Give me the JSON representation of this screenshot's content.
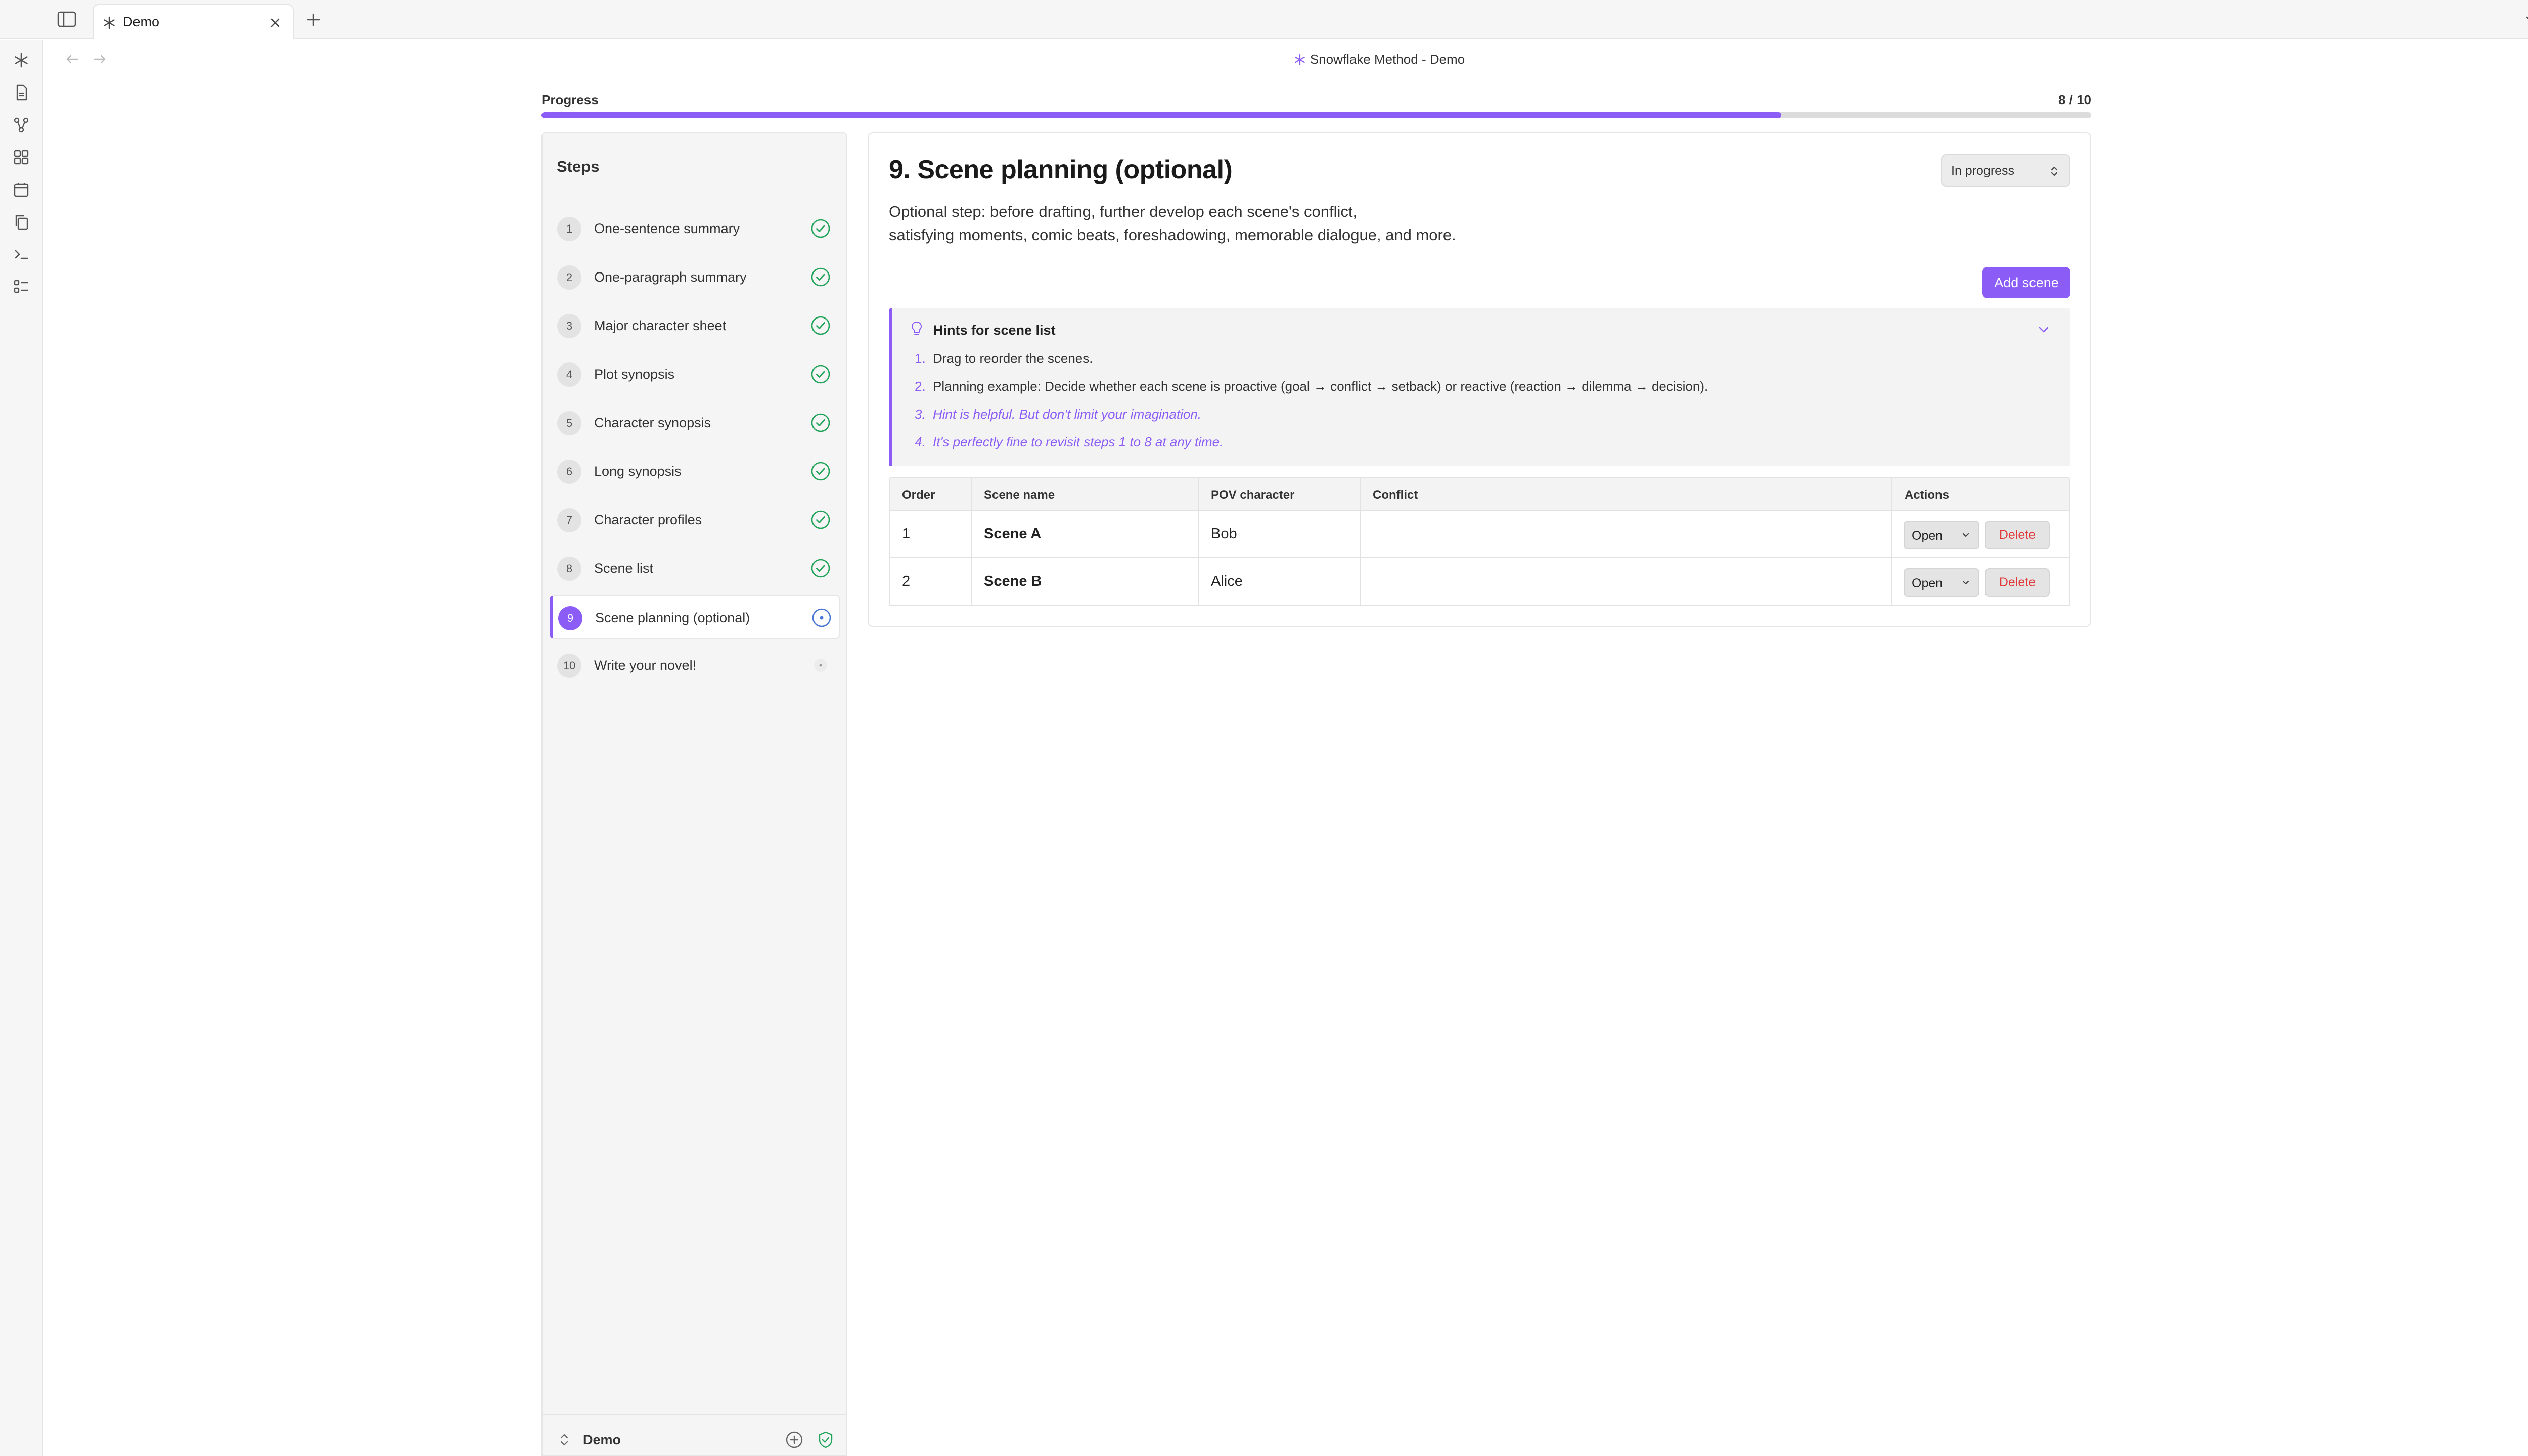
{
  "tab": {
    "label": "Demo"
  },
  "view": {
    "title": "Snowflake Method - Demo"
  },
  "progress": {
    "label": "Progress",
    "current": 8,
    "total": 10,
    "text": "8 / 10"
  },
  "steps": {
    "title": "Steps",
    "items": [
      {
        "num": "1",
        "label": "One-sentence summary",
        "status": "done"
      },
      {
        "num": "2",
        "label": "One-paragraph summary",
        "status": "done"
      },
      {
        "num": "3",
        "label": "Major character sheet",
        "status": "done"
      },
      {
        "num": "4",
        "label": "Plot synopsis",
        "status": "done"
      },
      {
        "num": "5",
        "label": "Character synopsis",
        "status": "done"
      },
      {
        "num": "6",
        "label": "Long synopsis",
        "status": "done"
      },
      {
        "num": "7",
        "label": "Character profiles",
        "status": "done"
      },
      {
        "num": "8",
        "label": "Scene list",
        "status": "done"
      },
      {
        "num": "9",
        "label": "Scene planning (optional)",
        "status": "in-progress"
      },
      {
        "num": "10",
        "label": "Write your novel!",
        "status": "todo"
      }
    ]
  },
  "vault": {
    "name": "Demo"
  },
  "main": {
    "heading": "9. Scene planning (optional)",
    "status_select": "In progress",
    "description_line1": "Optional step: before drafting, further develop each scene's conflict,",
    "description_line2": "satisfying moments, comic beats, foreshadowing, memorable dialogue, and more.",
    "add_scene_label": "Add scene"
  },
  "hints": {
    "title": "Hints for scene list",
    "items": [
      {
        "num": "1.",
        "text": "Drag to reorder the scenes."
      },
      {
        "num": "2.",
        "text": "Planning example: Decide whether each scene is proactive (goal → conflict → setback) or reactive (reaction → dilemma → decision)."
      },
      {
        "num": "3.",
        "text": "Hint is helpful. But don't limit your imagination."
      },
      {
        "num": "4.",
        "text": "It's perfectly fine to revisit steps 1 to 8 at any time."
      }
    ]
  },
  "table": {
    "headers": [
      "Order",
      "Scene name",
      "POV character",
      "Conflict",
      "Actions"
    ],
    "rows": [
      {
        "order": "1",
        "name": "Scene A",
        "pov": "Bob",
        "conflict": ""
      },
      {
        "order": "2",
        "name": "Scene B",
        "pov": "Alice",
        "conflict": ""
      }
    ],
    "open_label": "Open",
    "delete_label": "Delete"
  },
  "colors": {
    "accent": "#8b5cf6",
    "done": "#22a55a",
    "danger": "#e03b3b"
  }
}
